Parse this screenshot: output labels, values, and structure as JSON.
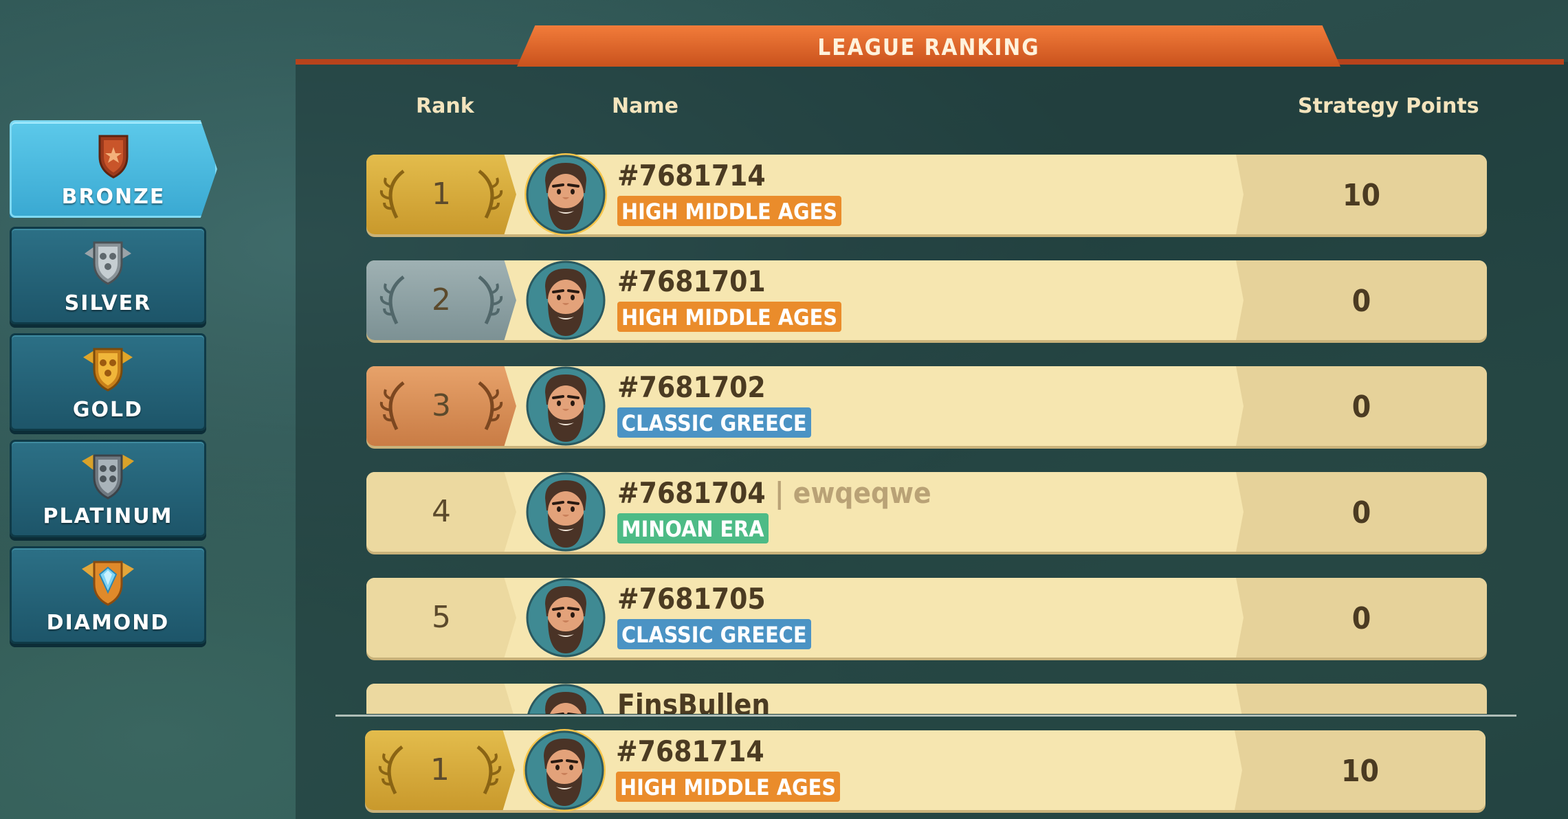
{
  "title": "LEAGUE RANKING",
  "columns": {
    "rank": "Rank",
    "name": "Name",
    "points": "Strategy Points"
  },
  "leagues": [
    {
      "label": "BRONZE",
      "icon": "bronze-shield-icon",
      "active": true
    },
    {
      "label": "SILVER",
      "icon": "silver-shield-icon",
      "active": false
    },
    {
      "label": "GOLD",
      "icon": "gold-shield-icon",
      "active": false
    },
    {
      "label": "PLATINUM",
      "icon": "platinum-shield-icon",
      "active": false
    },
    {
      "label": "DIAMOND",
      "icon": "diamond-shield-icon",
      "active": false
    }
  ],
  "rows": [
    {
      "rank": "1",
      "name": "#7681714",
      "alias": "",
      "era": "HIGH MIDDLE AGES",
      "era_color": "#ea8c2b",
      "points": "10"
    },
    {
      "rank": "2",
      "name": "#7681701",
      "alias": "",
      "era": "HIGH MIDDLE AGES",
      "era_color": "#ea8c2b",
      "points": "0"
    },
    {
      "rank": "3",
      "name": "#7681702",
      "alias": "",
      "era": "CLASSIC GREECE",
      "era_color": "#4b93c4",
      "points": "0"
    },
    {
      "rank": "4",
      "name": "#7681704",
      "alias": "| ewqeqwe",
      "era": "MINOAN ERA",
      "era_color": "#4dbb86",
      "points": "0"
    },
    {
      "rank": "5",
      "name": "#7681705",
      "alias": "",
      "era": "CLASSIC GREECE",
      "era_color": "#4b93c4",
      "points": "0"
    },
    {
      "rank": "",
      "name": "FinsBullen",
      "alias": "",
      "era": "",
      "era_color": "",
      "points": ""
    }
  ],
  "own_row": {
    "rank": "1",
    "name": "#7681714",
    "era": "HIGH MIDDLE AGES",
    "era_color": "#ea8c2b",
    "points": "10"
  }
}
